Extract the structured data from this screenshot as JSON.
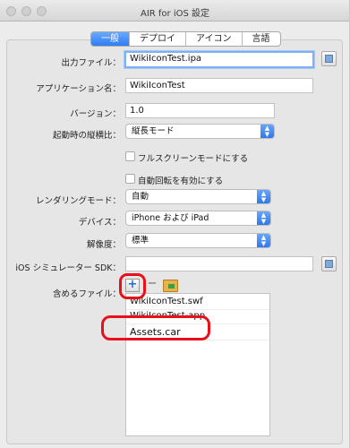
{
  "window": {
    "title": "AIR for iOS 設定"
  },
  "tabs": [
    "一般",
    "デプロイ",
    "アイコン",
    "言語"
  ],
  "form": {
    "output_file_label": "出力ファイル：",
    "output_file_value": "WikiIconTest.ipa",
    "app_name_label": "アプリケーション名：",
    "app_name_value": "WikiIconTest",
    "version_label": "バージョン：",
    "version_value": "1.0",
    "aspect_label": "起動時の縦横比：",
    "aspect_value": "縦長モード",
    "fullscreen_label": "フルスクリーンモードにする",
    "autorotate_label": "自動回転を有効にする",
    "render_mode_label": "レンダリングモード：",
    "render_mode_value": "自動",
    "device_label": "デバイス：",
    "device_value": "iPhone および iPad",
    "resolution_label": "解像度：",
    "resolution_value": "標準",
    "simulator_sdk_label": "iOS シミュレーター SDK：",
    "simulator_sdk_value": "",
    "include_files_label": "含めるファイル："
  },
  "included_files": [
    "WikiIconTest.swf",
    "WikiIconTest-app.",
    "Assets.car"
  ],
  "colors": {
    "accent": "#2f7cf5",
    "annotation": "#e8101a"
  }
}
